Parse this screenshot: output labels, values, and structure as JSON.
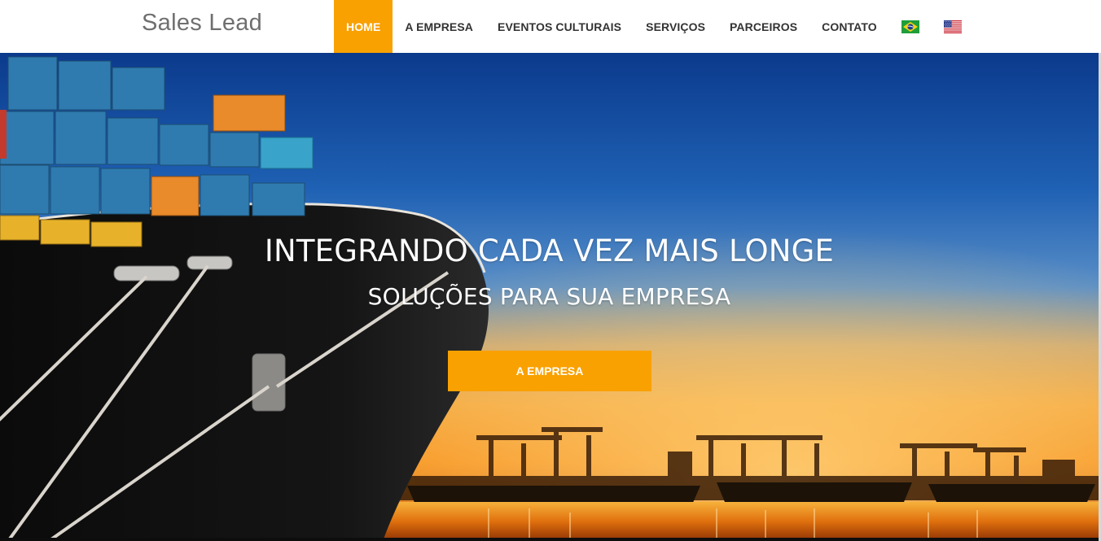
{
  "brand": "Sales Lead",
  "nav": {
    "items": [
      {
        "label": "HOME",
        "active": true
      },
      {
        "label": "A EMPRESA",
        "active": false
      },
      {
        "label": "EVENTOS CULTURAIS",
        "active": false
      },
      {
        "label": "SERVIÇOS",
        "active": false
      },
      {
        "label": "PARCEIROS",
        "active": false
      },
      {
        "label": "CONTATO",
        "active": false
      }
    ],
    "flags": [
      "brazil-flag-icon",
      "usa-flag-icon"
    ]
  },
  "hero": {
    "title": "INTEGRANDO CADA VEZ MAIS LONGE",
    "subtitle": "SOLUÇÕES PARA SUA EMPRESA",
    "button_label": "A EMPRESA"
  },
  "colors": {
    "accent": "#f9a100",
    "nav_text": "#333333",
    "brand_text": "#6f6f6f"
  }
}
